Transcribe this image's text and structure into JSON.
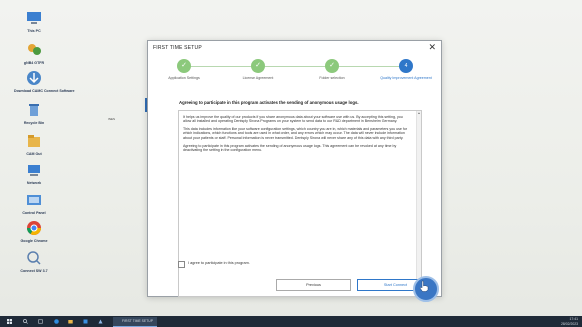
{
  "desktop_icons": [
    {
      "label": "This PC",
      "icon": "computer-icon"
    },
    {
      "label": "gNB4 GTFR",
      "icon": "recycle-users-icon"
    },
    {
      "label": "Download CAMC Connect Software",
      "icon": "download-icon"
    },
    {
      "label": "Recycle Bin",
      "icon": "recycle-bin-icon"
    },
    {
      "label": "CAM Out",
      "icon": "folder-icon"
    },
    {
      "label": "Network",
      "icon": "network-icon"
    },
    {
      "label": "Control Panel",
      "icon": "control-panel-icon"
    },
    {
      "label": "Google Chrome",
      "icon": "chrome-icon"
    },
    {
      "label": "Connect SW 3.7",
      "icon": "search-app-icon"
    }
  ],
  "side_marker_label": "INES",
  "dialog": {
    "title": "FIRST TIME SETUP",
    "close": "✕",
    "steps": [
      {
        "label": "Application Settings",
        "state": "done",
        "symbol": "✓"
      },
      {
        "label": "License Agreement",
        "state": "done",
        "symbol": "✓"
      },
      {
        "label": "Folder selection",
        "state": "done",
        "symbol": "✓"
      },
      {
        "label": "Quality Improvement Agreement",
        "state": "active",
        "symbol": "4"
      }
    ],
    "heading": "Agreeing to participate in this program activates the sending of anonymous usage logs.",
    "paragraphs": [
      "It helps us improve the quality of our products if you share anonymous data about your software use with us. By accepting this setting, you allow all installed and operating Dentsply Sirona Programs on your system to send data to our R&D department in Bensheim Germany.",
      "This data includes information like your software configuration settings, which country you are in, which materials and parameters you use for which indications, which functions and tools are used in what order, and any errors which may occur. The data will never include information about your patients or staff. Personal information is never transmitted. Dentsply Sirona will never share any of this data with any third party.",
      "Agreeing to participate in this program activates the sending of anonymous usage logs. This agreement can be revoked at any time by deactivating the setting in the configuration menu."
    ],
    "checkbox_label": "I agree to participate in this program.",
    "checkbox_checked": false,
    "previous_label": "Previous",
    "start_label": "Start Connect"
  },
  "taskbar": {
    "active_window": "FIRST TIME SETUP",
    "time": "17:41",
    "date": "28/02/2023"
  },
  "colors": {
    "accent": "#2f77c9",
    "done_step": "#8cc97c",
    "taskbar": "#1f2a38"
  }
}
